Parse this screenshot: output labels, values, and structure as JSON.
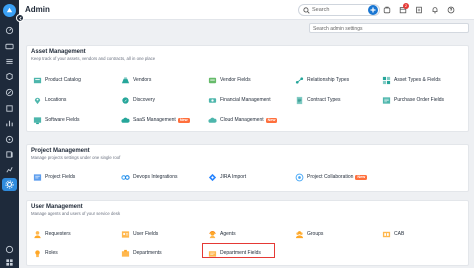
{
  "topbar": {
    "title": "Admin",
    "search_placeholder": "Search",
    "notification_count": "2",
    "avatar_initials": "JS"
  },
  "admin_search": {
    "placeholder": "Search admin settings"
  },
  "sections": {
    "asset": {
      "title": "Asset Management",
      "description": "Keep track of your assets, vendors and contracts, all in one place",
      "items": {
        "product_catalog": "Product Catalog",
        "vendors": "Vendors",
        "vendor_fields": "Vendor Fields",
        "relationship_types": "Relationship Types",
        "asset_types_fields": "Asset Types & Fields",
        "locations": "Locations",
        "discovery": "Discovery",
        "financial_management": "Financial Management",
        "contract_types": "Contract Types",
        "purchase_order_fields": "Purchase Order Fields",
        "software_fields": "Software Fields",
        "saas_management": "SaaS Management",
        "cloud_management": "Cloud Management"
      }
    },
    "project": {
      "title": "Project Management",
      "description": "Manage projects settings under one single roof",
      "items": {
        "project_fields": "Project Fields",
        "devops_integrations": "Devops Integrations",
        "jira_import": "JIRA Import",
        "project_collaboration": "Project Collaboration"
      }
    },
    "user": {
      "title": "User Management",
      "description": "Manage agents and users of your service desk",
      "items": {
        "requesters": "Requesters",
        "user_fields": "User Fields",
        "agents": "Agents",
        "groups": "Groups",
        "cab": "CAB",
        "roles": "Roles",
        "departments": "Departments",
        "department_fields": "Department Fields"
      }
    }
  },
  "badge_new": "New",
  "colors": {
    "rail": "#1e2a3b",
    "accent": "#1976d2",
    "new_badge": "#ff6f3c",
    "highlight": "#e53935"
  }
}
